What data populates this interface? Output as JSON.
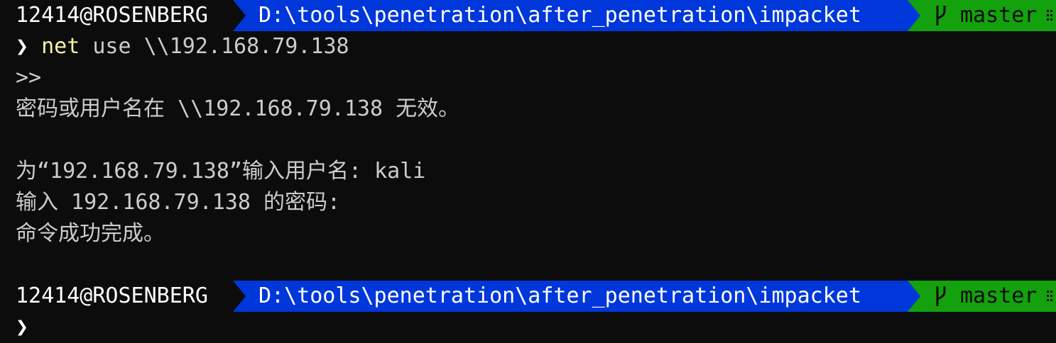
{
  "prompt": {
    "user_host": "12414@ROSENBERG",
    "path": "D:\\tools\\penetration\\after_penetration\\impacket",
    "branch": "master",
    "symbol": "❯"
  },
  "lines": {
    "cmd_name": "net",
    "cmd_args": " use \\\\192.168.79.138",
    "continuation": ">>",
    "error": "密码或用户名在 \\\\192.168.79.138 无效。",
    "user_prompt": "为“192.168.79.138”输入用户名: kali",
    "pass_prompt": "输入 192.168.79.138 的密码:",
    "success": "命令成功完成。"
  },
  "icons": {
    "branch": "git-branch-icon",
    "status": "git-status-icon"
  },
  "colors": {
    "background": "#0c0c0c",
    "path_segment": "#0037da",
    "git_segment": "#13a10e",
    "command": "#f9f1a5",
    "text": "#cccccc"
  }
}
